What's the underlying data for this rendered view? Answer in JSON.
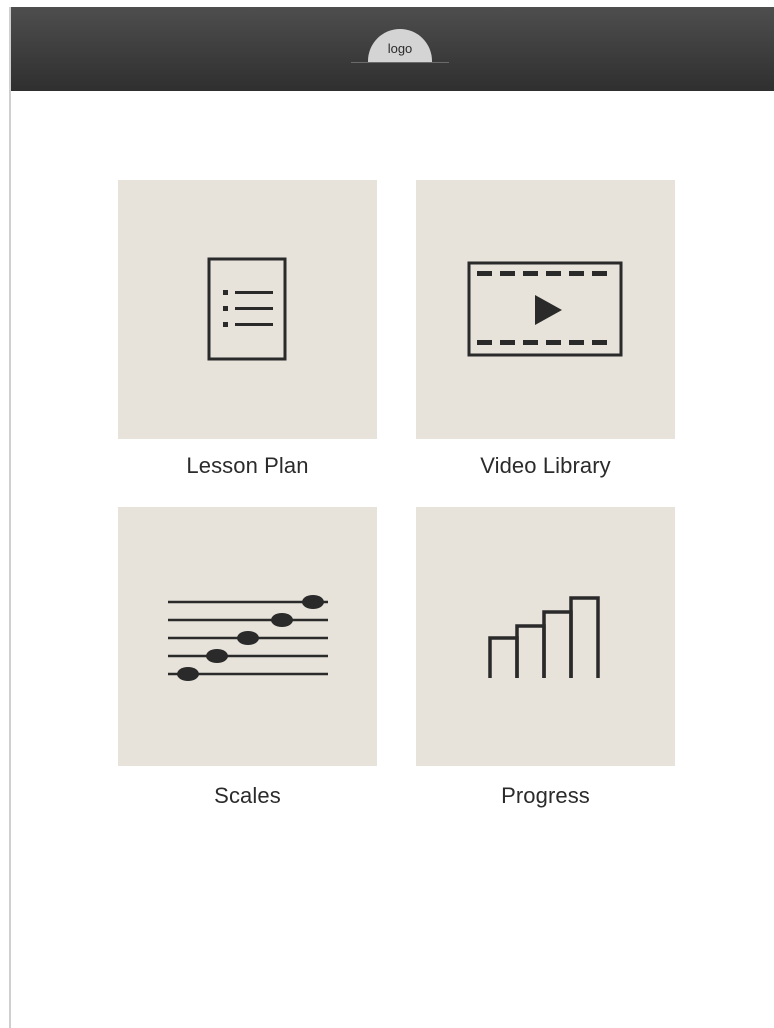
{
  "header": {
    "logo_text": "logo"
  },
  "menu": {
    "items": [
      {
        "label": "Lesson Plan",
        "icon": "document-list-icon"
      },
      {
        "label": "Video Library",
        "icon": "video-player-icon"
      },
      {
        "label": "Scales",
        "icon": "music-staff-icon"
      },
      {
        "label": "Progress",
        "icon": "bar-chart-icon"
      }
    ]
  },
  "colors": {
    "header_bg": "#3d3d3d",
    "tile_bg": "#e7e3da",
    "icon": "#2a2a2a",
    "label": "#2b2b2b"
  }
}
